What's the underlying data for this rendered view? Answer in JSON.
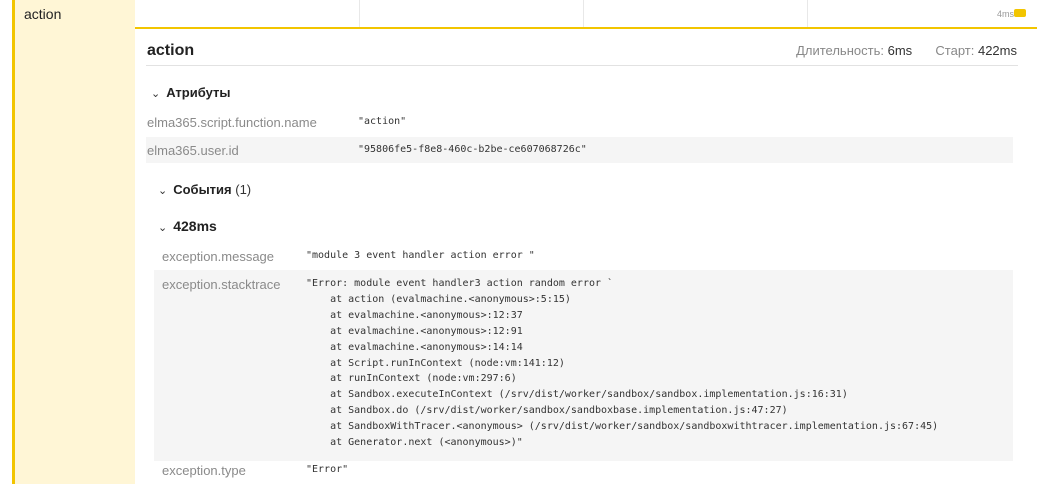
{
  "span": {
    "name": "action",
    "timeline_label": "4ms"
  },
  "detail": {
    "title": "action",
    "duration_label": "Длительность:",
    "duration_value": "6ms",
    "start_label": "Старт:",
    "start_value": "422ms"
  },
  "attributes": {
    "heading": "Атрибуты",
    "rows": [
      {
        "key": "elma365.script.function.name",
        "value": "\"action\""
      },
      {
        "key": "elma365.user.id",
        "value": "\"95806fe5-f8e8-460c-b2be-ce607068726c\""
      }
    ]
  },
  "events": {
    "heading": "События",
    "count": "(1)",
    "event": {
      "time": "428ms",
      "message_key": "exception.message",
      "message_value": "\"module 3 event handler action error \"",
      "stack_key": "exception.stacktrace",
      "stack_value": "\"Error: module event handler3 action random error `\n    at action (evalmachine.<anonymous>:5:15)\n    at evalmachine.<anonymous>:12:37\n    at evalmachine.<anonymous>:12:91\n    at evalmachine.<anonymous>:14:14\n    at Script.runInContext (node:vm:141:12)\n    at runInContext (node:vm:297:6)\n    at Sandbox.executeInContext (/srv/dist/worker/sandbox/sandbox.implementation.js:16:31)\n    at Sandbox.do (/srv/dist/worker/sandbox/sandboxbase.implementation.js:47:27)\n    at SandboxWithTracer.<anonymous> (/srv/dist/worker/sandbox/sandboxwithtracer.implementation.js:67:45)\n    at Generator.next (<anonymous>)\"",
      "type_key": "exception.type",
      "type_value": "\"Error\""
    }
  },
  "colors": {
    "accent": "#f2c500",
    "row_highlight": "#fff6d6",
    "muted_text": "#8a8a8a",
    "shaded_row": "#f5f5f5"
  }
}
